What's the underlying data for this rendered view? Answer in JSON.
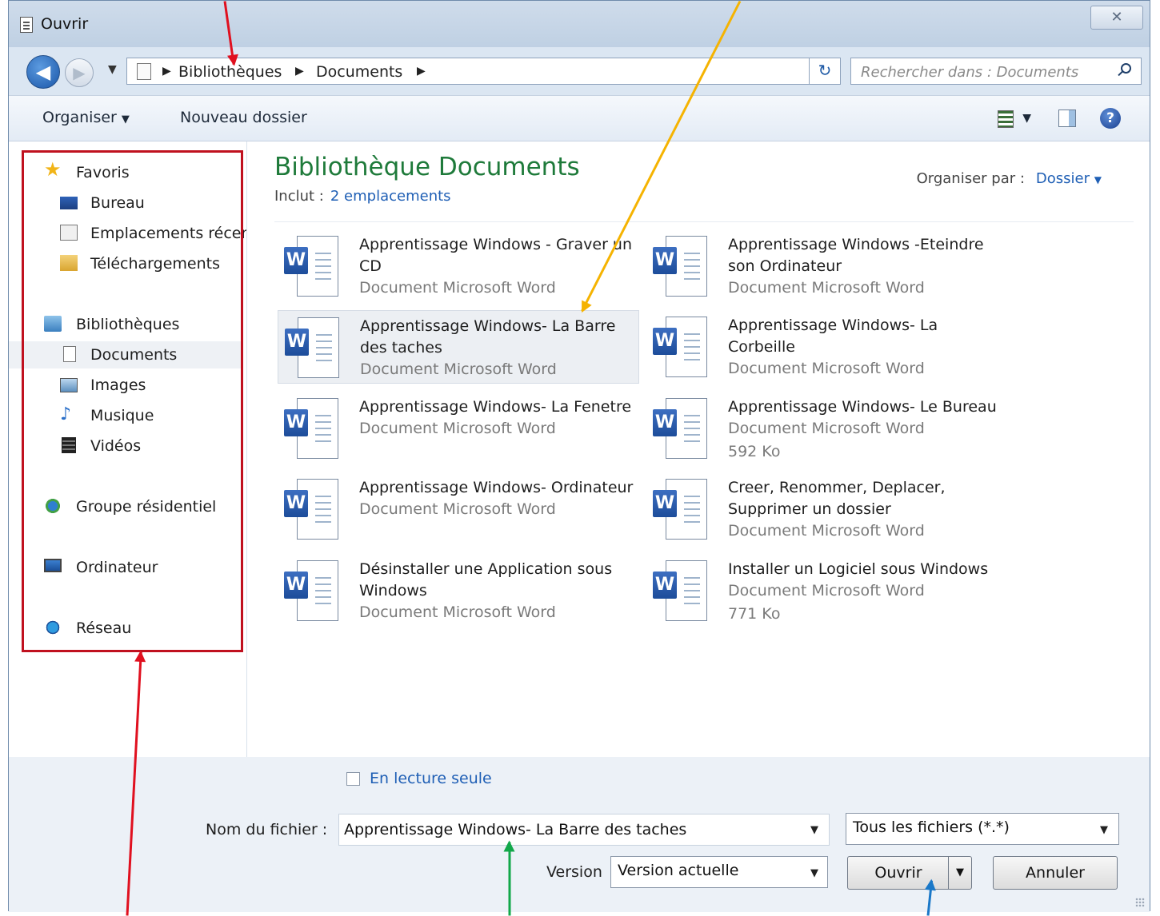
{
  "window": {
    "title": "Ouvrir",
    "close_glyph": "✕"
  },
  "nav": {
    "back_glyph": "◀",
    "forward_glyph": "▶",
    "breadcrumb": [
      "Bibliothèques",
      "Documents"
    ],
    "separator": "▶",
    "refresh_glyph": "↻",
    "search_placeholder": "Rechercher dans : Documents"
  },
  "toolbar": {
    "organize": "Organiser",
    "new_folder": "Nouveau dossier",
    "help": "?"
  },
  "sidebar": {
    "favorites": {
      "label": "Favoris",
      "items": [
        "Bureau",
        "Emplacements récents",
        "Téléchargements"
      ]
    },
    "libraries": {
      "label": "Bibliothèques",
      "items": [
        "Documents",
        "Images",
        "Musique",
        "Vidéos"
      ]
    },
    "homegroup": "Groupe résidentiel",
    "computer": "Ordinateur",
    "network": "Réseau",
    "selected": "Documents"
  },
  "library": {
    "title": "Bibliothèque Documents",
    "includes_label": "Inclut :",
    "includes_link": "2 emplacements",
    "arrange_label": "Organiser par :",
    "arrange_value": "Dossier"
  },
  "files": [
    {
      "name": "Apprentissage Windows - Graver un CD",
      "line2": "Document Microsoft Word",
      "line3": ""
    },
    {
      "name": "Apprentissage Windows -Eteindre son Ordinateur",
      "line2": "Document Microsoft Word",
      "line3": ""
    },
    {
      "name": "Apprentissage Windows- La Barre des taches",
      "line2": "Document Microsoft Word",
      "line3": ""
    },
    {
      "name": "Apprentissage Windows- La Corbeille",
      "line2": "Document Microsoft Word",
      "line3": ""
    },
    {
      "name": "Apprentissage Windows- La Fenetre",
      "line2": "Document Microsoft Word",
      "line3": ""
    },
    {
      "name": "Apprentissage Windows- Le Bureau",
      "line2": "Document Microsoft Word",
      "line3": "592 Ko"
    },
    {
      "name": "Apprentissage Windows- Ordinateur",
      "line2": "Document Microsoft Word",
      "line3": ""
    },
    {
      "name": "Creer, Renommer, Deplacer, Supprimer un dossier",
      "line2": "Document Microsoft Word",
      "line3": ""
    },
    {
      "name": "Désinstaller une Application sous Windows",
      "line2": "Document Microsoft Word",
      "line3": ""
    },
    {
      "name": "Installer un Logiciel sous Windows",
      "line2": "Document Microsoft Word",
      "line3": "771 Ko"
    }
  ],
  "selected_file": "Apprentissage Windows- La Barre des taches",
  "footer": {
    "readonly_label": "En lecture seule",
    "filename_label": "Nom du fichier :",
    "filename_value": "Apprentissage Windows- La Barre des taches",
    "filetype_value": "Tous les fichiers (*.*)",
    "version_label": "Version",
    "version_value": "Version actuelle",
    "open_button": "Ouvrir",
    "cancel_button": "Annuler"
  },
  "annotation_colors": {
    "red": "#e0101f",
    "orange": "#f5b301",
    "green": "#12a84a",
    "blue": "#1a78c8"
  },
  "icon_word_letter": "W"
}
